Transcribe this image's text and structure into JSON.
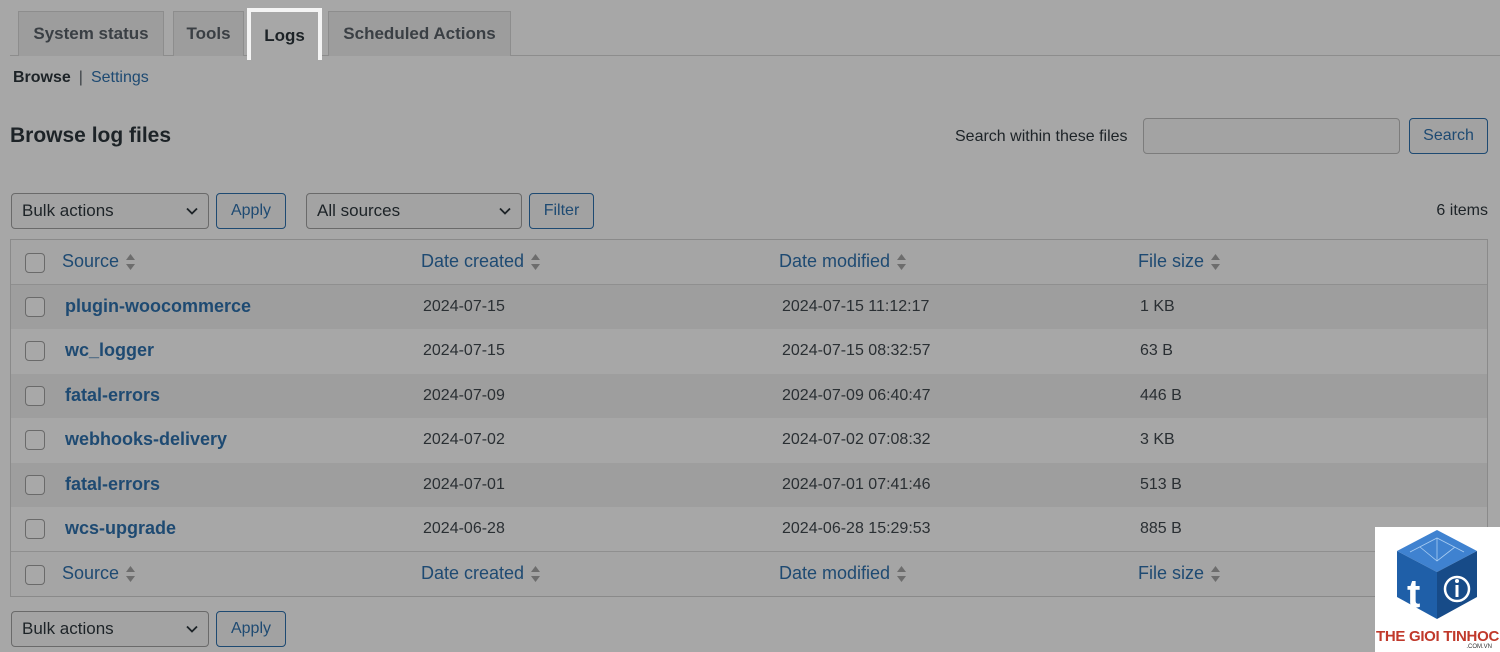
{
  "tabs": [
    {
      "label": "System status"
    },
    {
      "label": "Tools"
    },
    {
      "label": "Logs",
      "active": true
    },
    {
      "label": "Scheduled Actions"
    }
  ],
  "subnav": {
    "browse": "Browse",
    "separator": "|",
    "settings": "Settings"
  },
  "page_title": "Browse log files",
  "search": {
    "label": "Search within these files",
    "value": "",
    "button": "Search"
  },
  "top_actions": {
    "bulk_select": "Bulk actions",
    "apply": "Apply",
    "source_select": "All sources",
    "filter": "Filter"
  },
  "items_count": "6 items",
  "columns": {
    "source": "Source",
    "date_created": "Date created",
    "date_modified": "Date modified",
    "file_size": "File size"
  },
  "rows": [
    {
      "source": "plugin-woocommerce",
      "created": "2024-07-15",
      "modified": "2024-07-15 11:12:17",
      "size": "1 KB"
    },
    {
      "source": "wc_logger",
      "created": "2024-07-15",
      "modified": "2024-07-15 08:32:57",
      "size": "63 B"
    },
    {
      "source": "fatal-errors",
      "created": "2024-07-09",
      "modified": "2024-07-09 06:40:47",
      "size": "446 B"
    },
    {
      "source": "webhooks-delivery",
      "created": "2024-07-02",
      "modified": "2024-07-02 07:08:32",
      "size": "3 KB"
    },
    {
      "source": "fatal-errors",
      "created": "2024-07-01",
      "modified": "2024-07-01 07:41:46",
      "size": "513 B"
    },
    {
      "source": "wcs-upgrade",
      "created": "2024-06-28",
      "modified": "2024-06-28 15:29:53",
      "size": "885 B"
    }
  ],
  "bottom_actions": {
    "bulk_select": "Bulk actions",
    "apply": "Apply"
  },
  "watermark": {
    "text": "THE GIOI TINHOC",
    "sub": ".COM.VN"
  },
  "colors": {
    "link": "#1e4a72",
    "background": "#a7a7a7",
    "brand_red": "#c0392b",
    "brand_blue": "#1f5fa8"
  }
}
